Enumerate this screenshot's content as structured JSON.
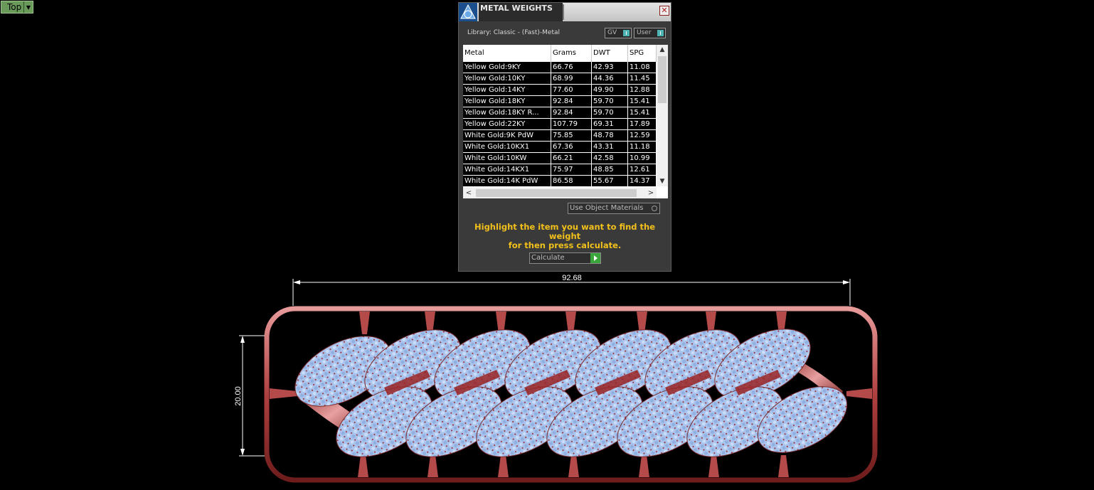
{
  "viewport": {
    "view_label": "Top",
    "dimensions": {
      "width": "92.68",
      "height": "20.00"
    }
  },
  "dialog": {
    "title": "METAL WEIGHTS",
    "library": "Library: Classic - (Fast)-Metal",
    "toggles": {
      "gv": "GV",
      "user": "User"
    },
    "columns": [
      "Metal",
      "Grams",
      "DWT",
      "SPG"
    ],
    "rows": [
      {
        "metal": "Yellow Gold:9KY",
        "grams": "66.76",
        "dwt": "42.93",
        "spg": "11.08"
      },
      {
        "metal": "Yellow Gold:10KY",
        "grams": "68.99",
        "dwt": "44.36",
        "spg": "11.45"
      },
      {
        "metal": "Yellow Gold:14KY",
        "grams": "77.60",
        "dwt": "49.90",
        "spg": "12.88"
      },
      {
        "metal": "Yellow Gold:18KY",
        "grams": "92.84",
        "dwt": "59.70",
        "spg": "15.41"
      },
      {
        "metal": "Yellow Gold:18KY R...",
        "grams": "92.84",
        "dwt": "59.70",
        "spg": "15.41"
      },
      {
        "metal": "Yellow Gold:22KY",
        "grams": "107.79",
        "dwt": "69.31",
        "spg": "17.89"
      },
      {
        "metal": "White Gold:9K PdW",
        "grams": "75.85",
        "dwt": "48.78",
        "spg": "12.59"
      },
      {
        "metal": "White Gold:10KX1",
        "grams": "67.36",
        "dwt": "43.31",
        "spg": "11.18"
      },
      {
        "metal": "White Gold:10KW",
        "grams": "66.21",
        "dwt": "42.58",
        "spg": "10.99"
      },
      {
        "metal": "White Gold:14KX1",
        "grams": "75.97",
        "dwt": "48.85",
        "spg": "12.61"
      },
      {
        "metal": "White Gold:14K PdW",
        "grams": "86.58",
        "dwt": "55.67",
        "spg": "14.37"
      }
    ],
    "use_object_materials": "Use Object Materials",
    "hint_line1": "Highlight the item you want to find the weight",
    "hint_line2": "for then press calculate.",
    "calculate_label": "Calculate"
  },
  "colors": {
    "viewport_bg": "#000000",
    "view_button": "#6a9a5a",
    "panel_bg": "#3a3a3a",
    "hint_text": "#f2c01a",
    "metal": "#b84c4c",
    "gem": "#a9c3ec"
  }
}
